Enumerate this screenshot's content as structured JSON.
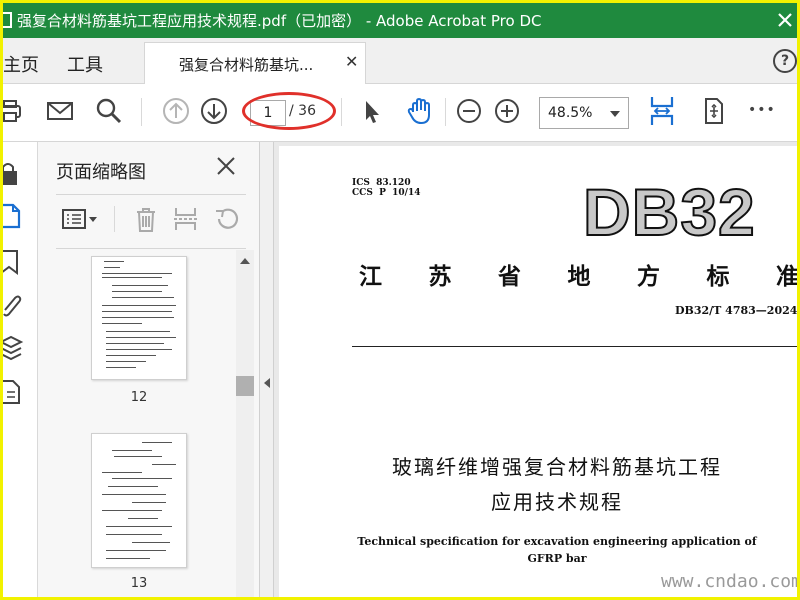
{
  "window": {
    "title": "强复合材料筋基坑工程应用技术规程.pdf（已加密） - Adobe Acrobat Pro DC",
    "accent": "#1f8a3e"
  },
  "tabs": {
    "home": "主页",
    "tools": "工具",
    "document": "强复合材料筋基坑...",
    "help": "?"
  },
  "toolbar": {
    "current_page": "1",
    "total_pages": "/ 36",
    "zoom": "48.5%",
    "more": "•••"
  },
  "thumbnails": {
    "title": "页面缩略图",
    "items": [
      {
        "page_label": "12"
      },
      {
        "page_label": "13"
      }
    ]
  },
  "document": {
    "ics": "ICS  83.120",
    "ccs": "CCS  P  10/14",
    "code": "DB32",
    "standard_type_chars": [
      "江",
      "苏",
      "省",
      "地",
      "方",
      "标",
      "准"
    ],
    "standard_number": "DB32/T 4783—2024",
    "title_cn_line1": "玻璃纤维增强复合材料筋基坑工程",
    "title_cn_line2": "应用技术规程",
    "title_en_line1": "Technical specification for excavation engineering application of",
    "title_en_line2": "GFRP bar"
  },
  "watermark": "www.cndao.com"
}
